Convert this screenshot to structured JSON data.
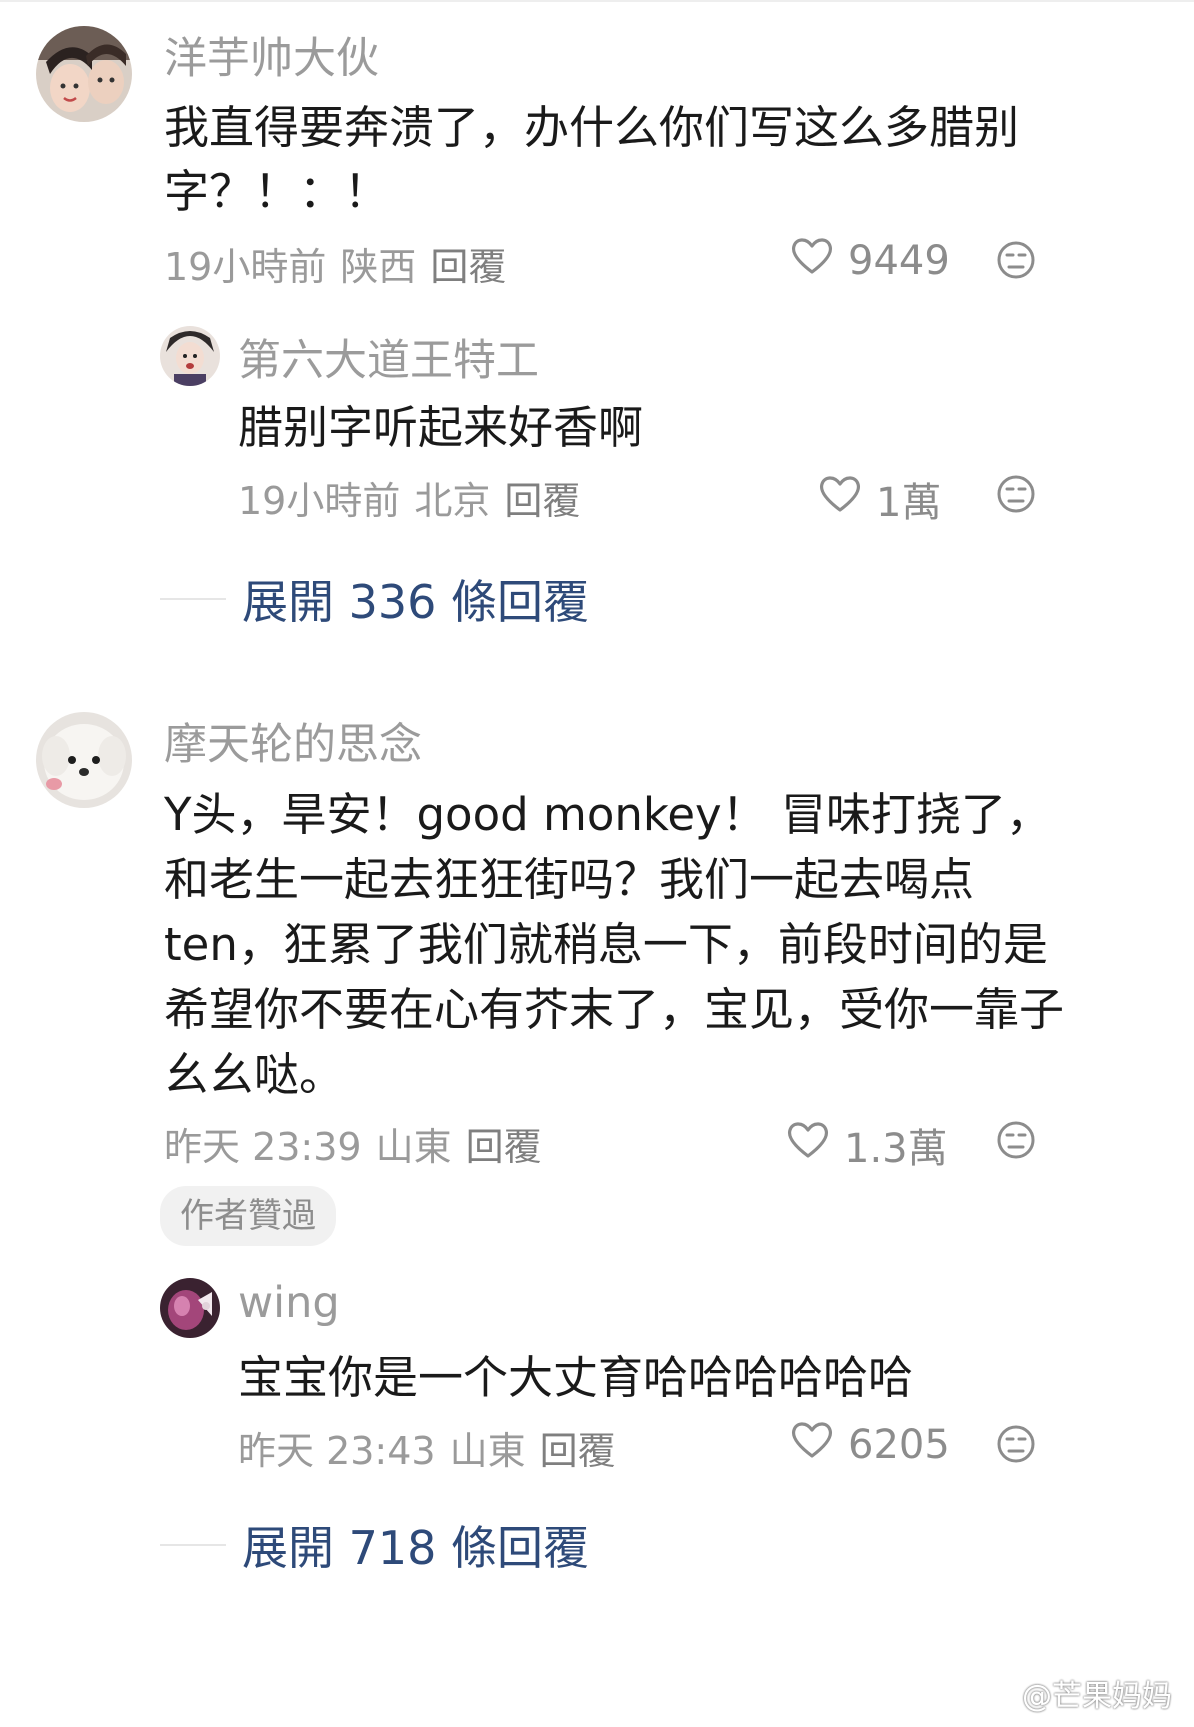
{
  "comments": [
    {
      "user": "洋芋帅大伙",
      "text": "我直得要奔溃了，办什么你们写这么多腊别字？！：！",
      "time": "19小時前",
      "location": "陕西",
      "reply_label": "回覆",
      "likes": "9449",
      "replies": [
        {
          "user": "第六大道王特工",
          "text": "腊别字听起来好香啊",
          "time": "19小時前",
          "location": "北京",
          "reply_label": "回覆",
          "likes": "1萬"
        }
      ],
      "expand_label": "展開 336 條回覆"
    },
    {
      "user": "摩天轮的思念",
      "text": "Y头，旱安！good monkey！ 冒味打挠了，和老生一起去狂狂街吗？我们一起去喝点ten，狂累了我们就稍息一下，前段时间的是希望你不要在心有芥末了，宝见，受你一靠子 幺幺哒。",
      "time": "昨天 23:39",
      "location": "山東",
      "reply_label": "回覆",
      "likes": "1.3萬",
      "badge": "作者贊過",
      "replies": [
        {
          "user": "wing",
          "text": "宝宝你是一个大丈育哈哈哈哈哈哈",
          "time": "昨天 23:43",
          "location": "山東",
          "reply_label": "回覆",
          "likes": "6205"
        }
      ],
      "expand_label": "展開 718 條回覆"
    }
  ],
  "watermark": "@芒果妈妈",
  "icons": {
    "like": "heart-outline-icon",
    "dislike": "unamused-face-icon",
    "watermark": "weibo-icon"
  },
  "colors": {
    "username": "#9b9b9b",
    "meta": "#9a9a9a",
    "expand_link": "#2e4a79",
    "badge_bg": "#f1f1f1"
  }
}
